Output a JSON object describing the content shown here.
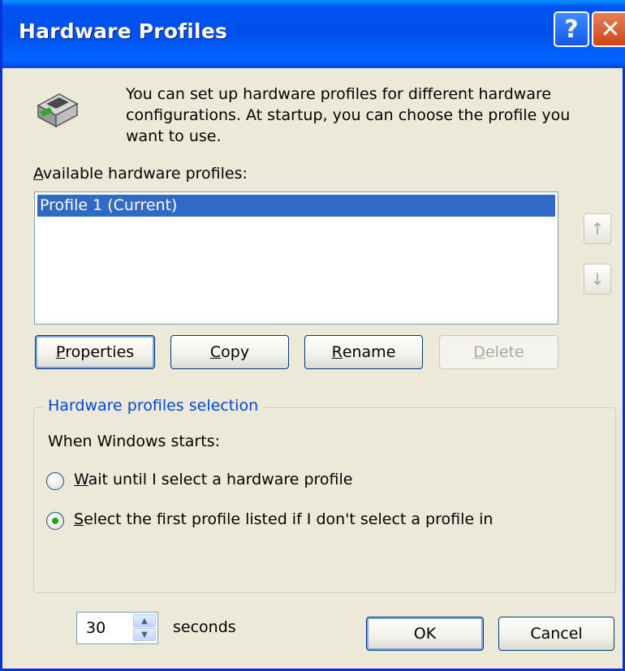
{
  "window": {
    "title": "Hardware Profiles",
    "help_label": "?",
    "close_label": "✕"
  },
  "intro": {
    "icon": "hardware-computer-icon",
    "text": "You can set up hardware profiles for different hardware configurations.  At startup, you can choose the profile you want to use."
  },
  "profiles": {
    "label_mnemonic": "A",
    "label_rest": "vailable hardware profiles:",
    "items": [
      "Profile 1 (Current)"
    ],
    "selected_index": 0,
    "move_up_icon": "arrow-up-icon",
    "move_down_icon": "arrow-down-icon"
  },
  "buttons": {
    "properties": {
      "mnemonic": "P",
      "rest": "roperties"
    },
    "copy": {
      "mnemonic": "C",
      "rest": "opy"
    },
    "rename": {
      "mnemonic": "R",
      "rest": "ename"
    },
    "delete": {
      "mnemonic": "D",
      "rest": "elete",
      "disabled": true
    }
  },
  "selection": {
    "legend": "Hardware profiles selection",
    "when_label": "When Windows starts:",
    "option_wait": {
      "mnemonic": "W",
      "rest": "ait until I select a hardware profile",
      "checked": false
    },
    "option_first": {
      "mnemonic": "S",
      "rest": "elect the first profile listed if I don't select a profile in",
      "checked": true
    },
    "seconds_value": "30",
    "seconds_label": "seconds"
  },
  "footer": {
    "ok_label": "OK",
    "cancel_label": "Cancel"
  },
  "colors": {
    "titlebar": "#0054e3",
    "selection": "#316ac5",
    "group_legend": "#0046d5",
    "dialog_bg": "#ece9d8"
  }
}
